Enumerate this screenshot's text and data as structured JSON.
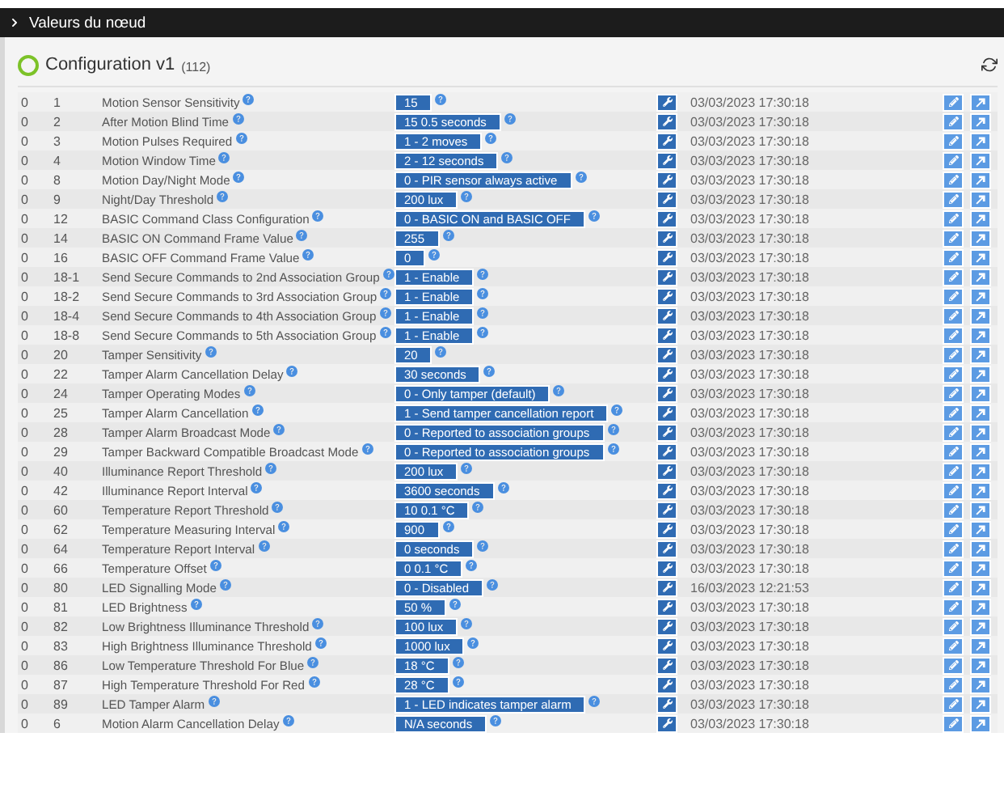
{
  "header": {
    "title": "Valeurs du nœud"
  },
  "panel": {
    "title": "Configuration v1",
    "count": "(112)"
  },
  "rows": [
    {
      "instance": "0",
      "index": "1",
      "label": "Motion Sensor Sensitivity",
      "value": "15",
      "updated": "03/03/2023 17:30:18"
    },
    {
      "instance": "0",
      "index": "2",
      "label": "After Motion Blind Time",
      "value": "15 0.5 seconds",
      "updated": "03/03/2023 17:30:18"
    },
    {
      "instance": "0",
      "index": "3",
      "label": "Motion Pulses Required",
      "value": "1 - 2 moves",
      "updated": "03/03/2023 17:30:18"
    },
    {
      "instance": "0",
      "index": "4",
      "label": "Motion Window Time",
      "value": "2 - 12 seconds",
      "updated": "03/03/2023 17:30:18"
    },
    {
      "instance": "0",
      "index": "8",
      "label": "Motion Day/Night Mode",
      "value": "0 - PIR sensor always active",
      "updated": "03/03/2023 17:30:18"
    },
    {
      "instance": "0",
      "index": "9",
      "label": "Night/Day Threshold",
      "value": "200 lux",
      "updated": "03/03/2023 17:30:18"
    },
    {
      "instance": "0",
      "index": "12",
      "label": "BASIC Command Class Configuration",
      "value": "0 - BASIC ON and BASIC OFF",
      "updated": "03/03/2023 17:30:18"
    },
    {
      "instance": "0",
      "index": "14",
      "label": "BASIC ON Command Frame Value",
      "value": "255",
      "updated": "03/03/2023 17:30:18"
    },
    {
      "instance": "0",
      "index": "16",
      "label": "BASIC OFF Command Frame Value",
      "value": "0",
      "updated": "03/03/2023 17:30:18"
    },
    {
      "instance": "0",
      "index": "18-1",
      "label": "Send Secure Commands to 2nd Association Group",
      "value": "1 - Enable",
      "updated": "03/03/2023 17:30:18"
    },
    {
      "instance": "0",
      "index": "18-2",
      "label": "Send Secure Commands to 3rd Association Group",
      "value": "1 - Enable",
      "updated": "03/03/2023 17:30:18"
    },
    {
      "instance": "0",
      "index": "18-4",
      "label": "Send Secure Commands to 4th Association Group",
      "value": "1 - Enable",
      "updated": "03/03/2023 17:30:18"
    },
    {
      "instance": "0",
      "index": "18-8",
      "label": "Send Secure Commands to 5th Association Group",
      "value": "1 - Enable",
      "updated": "03/03/2023 17:30:18"
    },
    {
      "instance": "0",
      "index": "20",
      "label": "Tamper Sensitivity",
      "value": "20",
      "updated": "03/03/2023 17:30:18"
    },
    {
      "instance": "0",
      "index": "22",
      "label": "Tamper Alarm Cancellation Delay",
      "value": "30 seconds",
      "updated": "03/03/2023 17:30:18"
    },
    {
      "instance": "0",
      "index": "24",
      "label": "Tamper Operating Modes",
      "value": "0 - Only tamper (default)",
      "updated": "03/03/2023 17:30:18"
    },
    {
      "instance": "0",
      "index": "25",
      "label": "Tamper Alarm Cancellation",
      "value": "1 - Send tamper cancellation report",
      "updated": "03/03/2023 17:30:18"
    },
    {
      "instance": "0",
      "index": "28",
      "label": "Tamper Alarm Broadcast Mode",
      "value": "0 - Reported to association groups",
      "updated": "03/03/2023 17:30:18"
    },
    {
      "instance": "0",
      "index": "29",
      "label": "Tamper Backward Compatible Broadcast Mode",
      "value": "0 - Reported to association groups",
      "updated": "03/03/2023 17:30:18"
    },
    {
      "instance": "0",
      "index": "40",
      "label": "Illuminance Report Threshold",
      "value": "200 lux",
      "updated": "03/03/2023 17:30:18"
    },
    {
      "instance": "0",
      "index": "42",
      "label": "Illuminance Report Interval",
      "value": "3600 seconds",
      "updated": "03/03/2023 17:30:18"
    },
    {
      "instance": "0",
      "index": "60",
      "label": "Temperature Report Threshold",
      "value": "10 0.1 °C",
      "updated": "03/03/2023 17:30:18"
    },
    {
      "instance": "0",
      "index": "62",
      "label": "Temperature Measuring Interval",
      "value": "900",
      "updated": "03/03/2023 17:30:18"
    },
    {
      "instance": "0",
      "index": "64",
      "label": "Temperature Report Interval",
      "value": "0 seconds",
      "updated": "03/03/2023 17:30:18"
    },
    {
      "instance": "0",
      "index": "66",
      "label": "Temperature Offset",
      "value": "0 0.1 °C",
      "updated": "03/03/2023 17:30:18"
    },
    {
      "instance": "0",
      "index": "80",
      "label": "LED Signalling Mode",
      "value": "0 - Disabled",
      "updated": "16/03/2023 12:21:53"
    },
    {
      "instance": "0",
      "index": "81",
      "label": "LED Brightness",
      "value": "50 %",
      "updated": "03/03/2023 17:30:18"
    },
    {
      "instance": "0",
      "index": "82",
      "label": "Low Brightness Illuminance Threshold",
      "value": "100 lux",
      "updated": "03/03/2023 17:30:18"
    },
    {
      "instance": "0",
      "index": "83",
      "label": "High Brightness Illuminance Threshold",
      "value": "1000 lux",
      "updated": "03/03/2023 17:30:18"
    },
    {
      "instance": "0",
      "index": "86",
      "label": "Low Temperature Threshold For Blue",
      "value": "18 °C",
      "updated": "03/03/2023 17:30:18"
    },
    {
      "instance": "0",
      "index": "87",
      "label": "High Temperature Threshold For Red",
      "value": "28 °C",
      "updated": "03/03/2023 17:30:18"
    },
    {
      "instance": "0",
      "index": "89",
      "label": "LED Tamper Alarm",
      "value": "1 - LED indicates tamper alarm",
      "updated": "03/03/2023 17:30:18"
    },
    {
      "instance": "0",
      "index": "6",
      "label": "Motion Alarm Cancellation Delay",
      "value": "N/A seconds",
      "updated": "03/03/2023 17:30:18"
    }
  ]
}
